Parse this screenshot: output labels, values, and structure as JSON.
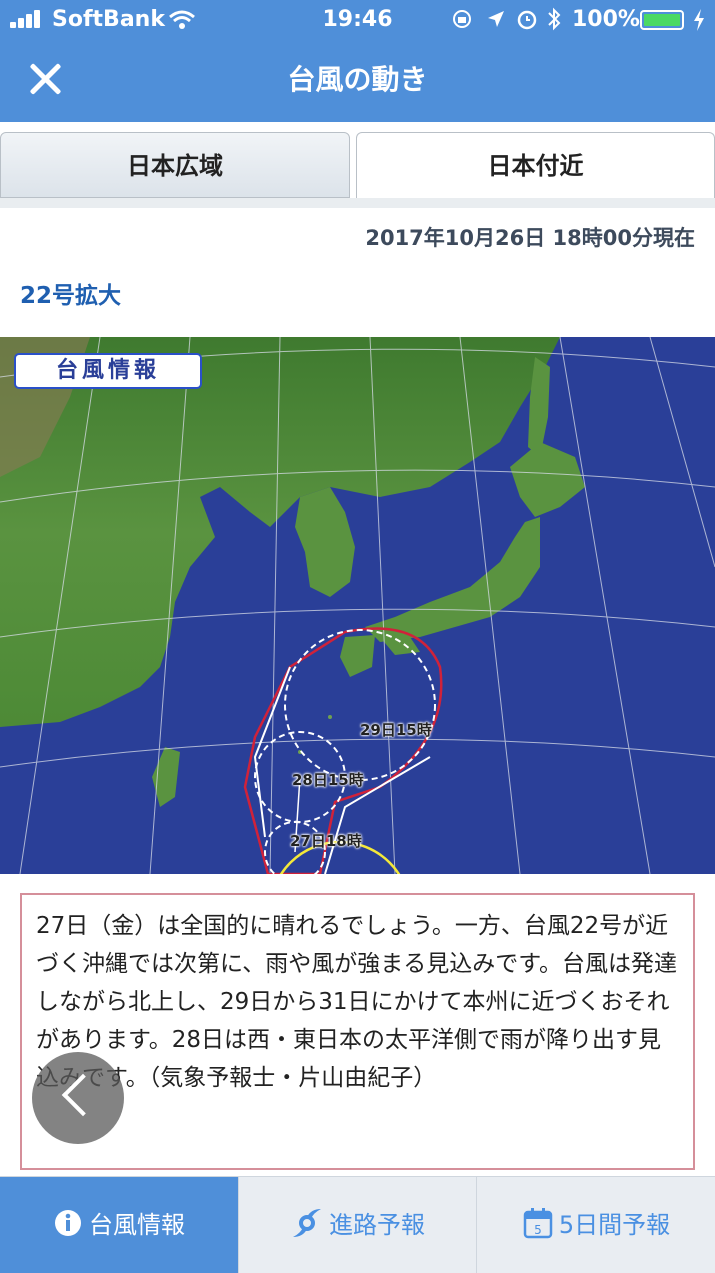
{
  "status_bar": {
    "carrier": "SoftBank",
    "time": "19:46",
    "battery": "100%"
  },
  "header": {
    "title": "台風の動き"
  },
  "tabs": [
    {
      "label": "日本広域"
    },
    {
      "label": "日本付近"
    }
  ],
  "timestamp": "2017年10月26日 18時00分現在",
  "typhoon_label": "22号拡大",
  "map": {
    "badge": "台風情報",
    "forecasts": [
      "29日15時",
      "28日15時",
      "27日18時"
    ]
  },
  "description": "27日（金）は全国的に晴れるでしょう。一方、台風22号が近づく沖縄では次第に、雨や風が強まる見込みです。台風は発達しながら北上し、29日から31日にかけて本州に近づくおそれがあります。28日は西・東日本の太平洋側で雨が降り出す見込みです。（気象予報士・片山由紀子）",
  "bottom_tabs": [
    {
      "label": "台風情報",
      "icon": "info-icon"
    },
    {
      "label": "進路予報",
      "icon": "typhoon-icon"
    },
    {
      "label": "5日間予報",
      "icon": "calendar-icon",
      "icon_text": "5"
    }
  ],
  "colors": {
    "accent": "#4f8fd9",
    "storm_area": "#d0223a",
    "forecast_circle": "#ffffff",
    "sea": "#2a3f98",
    "land": "#4f8f3a",
    "text_box_border": "#d58f9a"
  }
}
